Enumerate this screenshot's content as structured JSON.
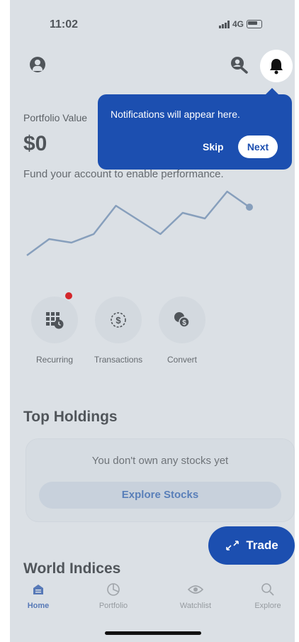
{
  "status_bar": {
    "time": "11:02",
    "network": "4G"
  },
  "portfolio": {
    "label": "Portfolio Value",
    "amount": "$0",
    "fund_message": "Fund your account to enable performance.",
    "chart_points": [
      0.1,
      0.33,
      0.28,
      0.4,
      0.8,
      0.6,
      0.4,
      0.7,
      0.62,
      1.0,
      0.78
    ]
  },
  "actions": [
    {
      "label": "Recurring",
      "icon": "calendar-clock-icon"
    },
    {
      "label": "Transactions",
      "icon": "dollar-cycle-icon"
    },
    {
      "label": "Convert",
      "icon": "convert-currency-icon"
    }
  ],
  "top_holdings": {
    "title": "Top Holdings",
    "empty_message": "You don't own any stocks yet",
    "button": "Explore Stocks"
  },
  "trade_button": "Trade",
  "world_indices": {
    "title": "World Indices"
  },
  "tabs": [
    {
      "label": "Home",
      "icon": "home-icon",
      "active": true
    },
    {
      "label": "Portfolio",
      "icon": "portfolio-icon",
      "active": false
    },
    {
      "label": "Watchlist",
      "icon": "eye-icon",
      "active": false
    },
    {
      "label": "Explore",
      "icon": "search-icon",
      "active": false
    }
  ],
  "tooltip": {
    "message": "Notifications will appear here.",
    "skip": "Skip",
    "next": "Next"
  },
  "colors": {
    "brand": "#1c4fb0",
    "chart_line": "#6f8fb8",
    "badge": "#d3272b"
  }
}
